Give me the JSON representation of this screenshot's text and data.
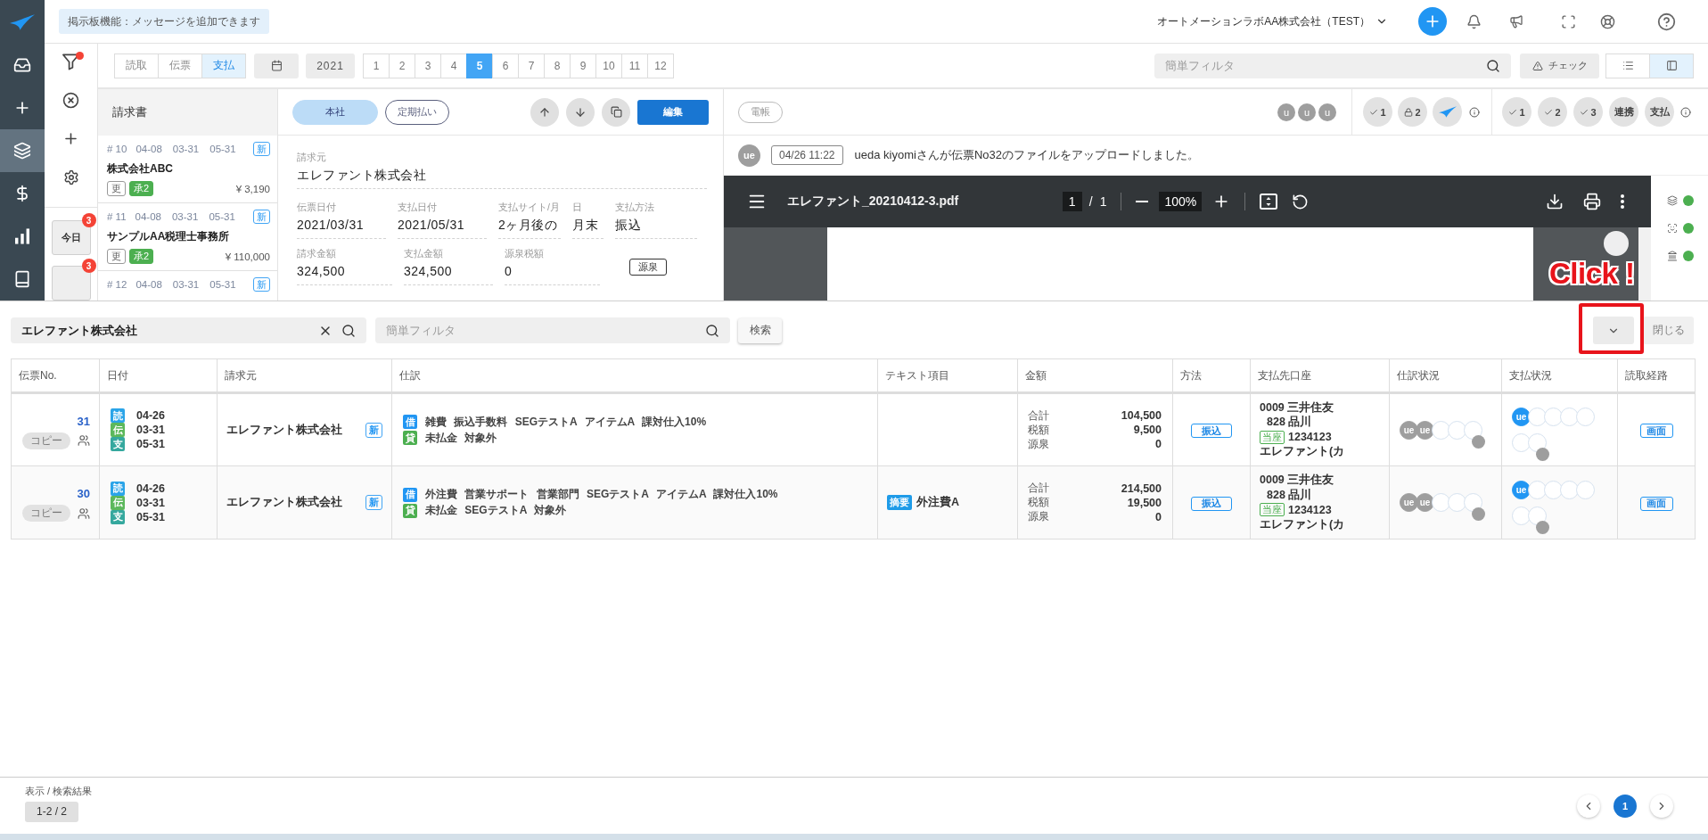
{
  "sidebar": {
    "items": [
      {
        "selected": false
      },
      {
        "selected": false
      },
      {
        "selected": true
      },
      {
        "selected": false
      },
      {
        "selected": false
      },
      {
        "selected": false
      }
    ]
  },
  "header": {
    "notice": "掲示板機能：メッセージを追加できます",
    "company": "オートメーションラボAA株式会社（TEST）"
  },
  "filter_column": {
    "filter_applied": true,
    "day_buttons": [
      {
        "label": "今日",
        "badge": "3"
      },
      {
        "badge": "3"
      }
    ]
  },
  "toolbar": {
    "modes": [
      {
        "label": "読取",
        "selected": false
      },
      {
        "label": "伝票",
        "selected": false
      },
      {
        "label": "支払",
        "selected": true
      }
    ],
    "year": "2021",
    "months": [
      {
        "label": "1",
        "selected": false
      },
      {
        "label": "2",
        "selected": false
      },
      {
        "label": "3",
        "selected": false
      },
      {
        "label": "4",
        "selected": false
      },
      {
        "label": "5",
        "selected": true
      },
      {
        "label": "6",
        "selected": false
      },
      {
        "label": "7",
        "selected": false
      },
      {
        "label": "8",
        "selected": false
      },
      {
        "label": "9",
        "selected": false
      },
      {
        "label": "10",
        "selected": false
      },
      {
        "label": "11",
        "selected": false
      },
      {
        "label": "12",
        "selected": false
      }
    ],
    "filter_placeholder": "簡単フィルタ",
    "check_button": "チェック",
    "views": [
      {
        "selected": false
      },
      {
        "selected": true
      }
    ]
  },
  "invoice_list": {
    "title": "請求書",
    "items": [
      {
        "number": "# 10",
        "dates": [
          "04-08",
          "03-31",
          "05-31"
        ],
        "badge": "新",
        "name": "株式会社ABC",
        "tags": [
          {
            "label": "更",
            "kind": "outline"
          },
          {
            "label": "承2",
            "kind": "approved"
          }
        ],
        "amount": "¥ 3,190"
      },
      {
        "number": "# 11",
        "dates": [
          "04-08",
          "03-31",
          "05-31"
        ],
        "badge": "新",
        "name": "サンプルAA税理士事務所",
        "tags": [
          {
            "label": "更",
            "kind": "outline"
          },
          {
            "label": "承2",
            "kind": "approved"
          }
        ],
        "amount": "¥ 110,000"
      },
      {
        "number": "# 12",
        "dates": [
          "04-08",
          "03-31",
          "05-31"
        ],
        "badge": "新"
      }
    ]
  },
  "detail": {
    "tags": [
      {
        "label": "本社",
        "kind": "filled"
      },
      {
        "label": "定期払い",
        "kind": "outline"
      }
    ],
    "edit_button": "編集",
    "vendor": {
      "label": "請求元",
      "value": "エレファント株式会社"
    },
    "field_rows": [
      [
        {
          "label": "伝票日付",
          "value": "2021/03/31"
        },
        {
          "label": "支払日付",
          "value": "2021/05/31"
        },
        {
          "label": "支払サイト/月",
          "value": "2ヶ月後の"
        },
        {
          "label": "日",
          "value": "月末"
        },
        {
          "label": "支払方法",
          "value": "振込"
        }
      ],
      [
        {
          "label": "請求金額",
          "value": "324,500"
        },
        {
          "label": "支払金額",
          "value": "324,500"
        },
        {
          "label": "源泉税額",
          "value": "0"
        }
      ]
    ],
    "withholding_button": "源泉"
  },
  "document_panel": {
    "ledger_tag": "電帳",
    "users": [
      "u",
      "u",
      "u"
    ],
    "status_groups": [
      [
        {
          "kind": "check",
          "label": "1"
        },
        {
          "kind": "lock",
          "label": "2"
        },
        {
          "kind": "logo"
        }
      ],
      [
        {
          "kind": "check",
          "label": "1"
        },
        {
          "kind": "check",
          "label": "2"
        },
        {
          "kind": "check",
          "label": "3"
        },
        {
          "kind": "text",
          "label": "連携"
        },
        {
          "kind": "text",
          "label": "支払"
        }
      ]
    ],
    "activity": {
      "avatar": "ue",
      "time": "04/26 11:22",
      "message": "ueda kiyomiさんが伝票No32のファイルをアップロードしました。"
    },
    "viewer": {
      "file_name": "エレファント_20210412-3.pdf",
      "page": "1",
      "page_separator": "/",
      "page_count": "1",
      "zoom": "100%"
    },
    "side_checks": [
      {
        "ok": true
      },
      {
        "ok": true
      },
      {
        "ok": true
      }
    ]
  },
  "annotation": {
    "callout": "Click !",
    "frame": true
  },
  "search": {
    "query": "エレファント株式会社",
    "filter_placeholder": "簡単フィルタ",
    "search_button": "検索",
    "close_button": "閉じる"
  },
  "table": {
    "columns": [
      "伝票No.",
      "日付",
      "請求元",
      "仕訳",
      "テキスト項目",
      "金額",
      "方法",
      "支払先口座",
      "仕訳状況",
      "支払状況",
      "読取経路"
    ],
    "rows": [
      {
        "number": "31",
        "copy_button": "コピー",
        "dates": [
          {
            "tag": "読",
            "color": "#2aa4e8",
            "value": "04-26"
          },
          {
            "tag": "伝",
            "color": "#5cb85c",
            "value": "03-31"
          },
          {
            "tag": "支",
            "color": "#35a89e",
            "value": "05-31"
          }
        ],
        "vendor": "エレファント株式会社",
        "vendor_badge": "新",
        "journal": [
          {
            "tag": "借",
            "color": "#2196f3",
            "text": "雑費 振込手数料 SEGテストA アイテムA 課対仕入10%"
          },
          {
            "tag": "貸",
            "color": "#4caf50",
            "text": "未払金 対象外"
          }
        ],
        "amounts": [
          {
            "label": "合計",
            "value": "104,500"
          },
          {
            "label": "税額",
            "value": "9,500"
          },
          {
            "label": "源泉",
            "value": "0"
          }
        ],
        "method": "振込",
        "account": {
          "bank": "0009 三井住友",
          "branch": "828 品川",
          "type": "当座",
          "number": "1234123",
          "holder": "エレファント(カ"
        },
        "journal_status": {
          "lines": [
            [
              {
                "kind": "stamp",
                "label": "ue",
                "color": "#9e9e9e"
              },
              {
                "kind": "stamp",
                "label": "ue",
                "color": "#9e9e9e"
              },
              {
                "kind": "empty"
              },
              {
                "kind": "empty"
              },
              {
                "kind": "empty"
              }
            ]
          ],
          "pending_dot": true
        },
        "payment_status": {
          "lines": [
            [
              {
                "kind": "stamp",
                "label": "ue",
                "color": "#2196f3"
              },
              {
                "kind": "empty"
              },
              {
                "kind": "empty"
              },
              {
                "kind": "empty"
              },
              {
                "kind": "empty"
              }
            ],
            [
              {
                "kind": "empty"
              },
              {
                "kind": "empty"
              }
            ]
          ],
          "pending_dot": true
        },
        "route": "画面"
      },
      {
        "number": "30",
        "copy_button": "コピー",
        "dates": [
          {
            "tag": "読",
            "color": "#2aa4e8",
            "value": "04-26"
          },
          {
            "tag": "伝",
            "color": "#5cb85c",
            "value": "03-31"
          },
          {
            "tag": "支",
            "color": "#35a89e",
            "value": "05-31"
          }
        ],
        "vendor": "エレファント株式会社",
        "vendor_badge": "新",
        "journal": [
          {
            "tag": "借",
            "color": "#2196f3",
            "text": "外注費 営業サポート 営業部門 SEGテストA アイテムA 課対仕入10%"
          },
          {
            "tag": "貸",
            "color": "#4caf50",
            "text": "未払金 SEGテストA 対象外"
          }
        ],
        "text_item": {
          "tag": "摘要",
          "value": "外注費A"
        },
        "amounts": [
          {
            "label": "合計",
            "value": "214,500"
          },
          {
            "label": "税額",
            "value": "19,500"
          },
          {
            "label": "源泉",
            "value": "0"
          }
        ],
        "method": "振込",
        "account": {
          "bank": "0009 三井住友",
          "branch": "828 品川",
          "type": "当座",
          "number": "1234123",
          "holder": "エレファント(カ"
        },
        "journal_status": {
          "lines": [
            [
              {
                "kind": "stamp",
                "label": "ue",
                "color": "#9e9e9e"
              },
              {
                "kind": "stamp",
                "label": "ue",
                "color": "#9e9e9e"
              },
              {
                "kind": "empty"
              },
              {
                "kind": "empty"
              },
              {
                "kind": "empty"
              }
            ]
          ],
          "pending_dot": true
        },
        "payment_status": {
          "lines": [
            [
              {
                "kind": "stamp",
                "label": "ue",
                "color": "#2196f3"
              },
              {
                "kind": "empty"
              },
              {
                "kind": "empty"
              },
              {
                "kind": "empty"
              },
              {
                "kind": "empty"
              }
            ],
            [
              {
                "kind": "empty"
              },
              {
                "kind": "empty"
              }
            ]
          ],
          "pending_dot": true
        },
        "route": "画面"
      }
    ]
  },
  "footer": {
    "summary_label": "表示 / 検索結果",
    "summary": "1-2 / 2",
    "pages": [
      {
        "label": "1",
        "selected": true
      }
    ]
  }
}
